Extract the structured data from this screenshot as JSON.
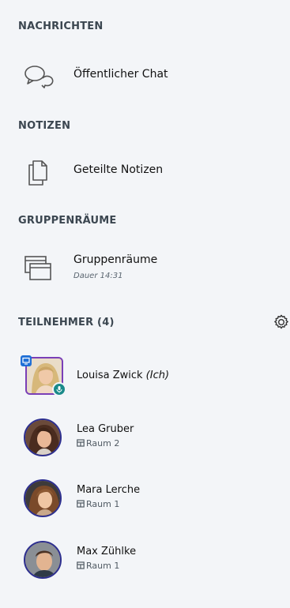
{
  "sections": {
    "messages": "NACHRICHTEN",
    "notes": "NOTIZEN",
    "breakout": "GRUPPENRÄUME",
    "participants": "TEILNEHMER (4)"
  },
  "items": {
    "public_chat": "Öffentlicher Chat",
    "shared_notes": "Geteilte Notizen",
    "breakout_rooms": "Gruppenräume",
    "breakout_duration": "Dauer 14:31"
  },
  "users": [
    {
      "name": "Louisa Zwick",
      "suffix": "(Ich)",
      "room": ""
    },
    {
      "name": "Lea Gruber",
      "room": "Raum 2"
    },
    {
      "name": "Mara Lerche",
      "room": "Raum 1"
    },
    {
      "name": "Max Zühlke",
      "room": "Raum 1"
    }
  ],
  "icons": {
    "chat": "chat-bubbles-icon",
    "notes": "documents-icon",
    "breakout": "windows-icon",
    "settings": "gear-icon",
    "room": "room-icon",
    "presenter": "screen-share-icon",
    "mic": "microphone-icon"
  },
  "colors": {
    "background": "#f3f5f8",
    "section_title": "#3b4650",
    "avatar_border": "#2d2f8f",
    "self_avatar_border": "#7a3fb7",
    "presenter_badge": "#1f6fd6",
    "mic_badge": "#1a8a8a"
  }
}
